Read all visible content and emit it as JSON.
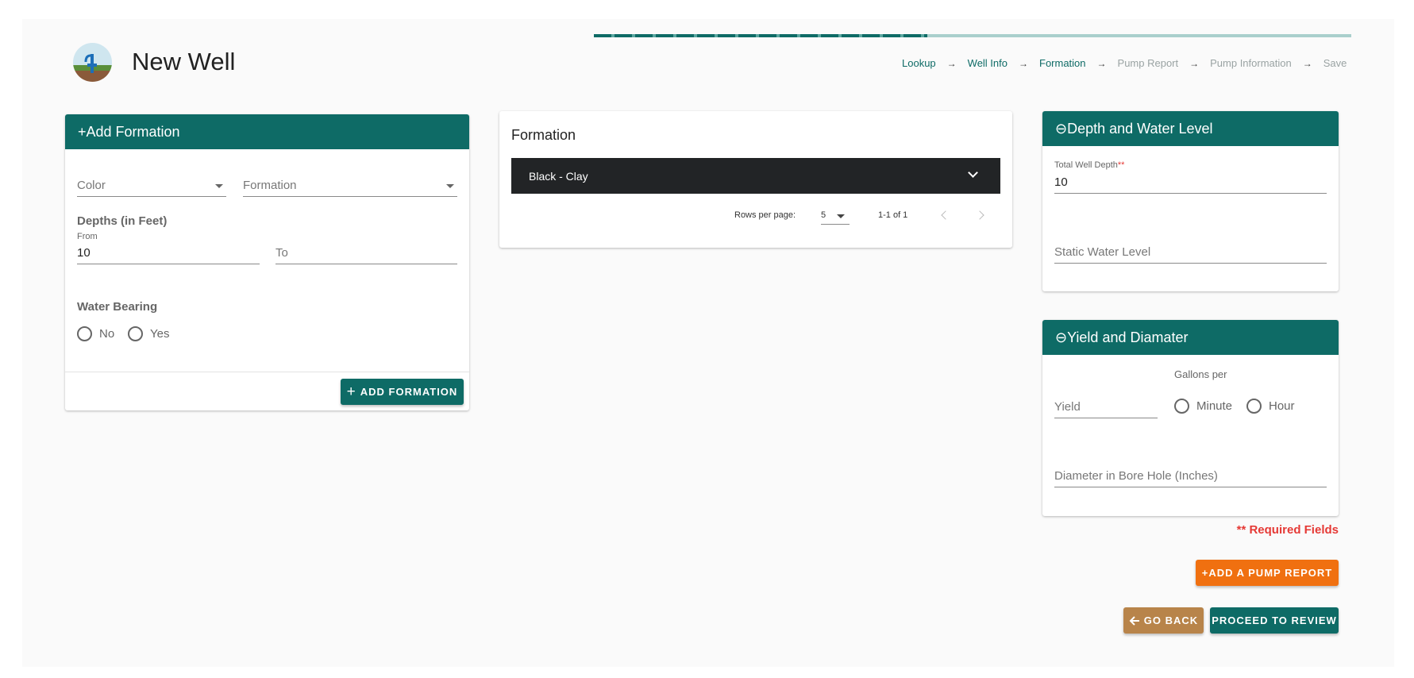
{
  "header": {
    "title": "New Well"
  },
  "progress": {
    "fraction": 0.44
  },
  "steps": [
    {
      "label": "Lookup",
      "state": "done"
    },
    {
      "label": "Well Info",
      "state": "done"
    },
    {
      "label": "Formation",
      "state": "done"
    },
    {
      "label": "Pump Report",
      "state": "todo"
    },
    {
      "label": "Pump Information",
      "state": "todo"
    },
    {
      "label": "Save",
      "state": "todo"
    }
  ],
  "step_arrow": "→",
  "add_formation": {
    "title": "+Add Formation",
    "color_placeholder": "Color",
    "formation_placeholder": "Formation",
    "depths_label": "Depths (in Feet)",
    "from_label": "From",
    "from_value": "10",
    "to_placeholder": "To",
    "water_bearing_label": "Water Bearing",
    "no_label": "No",
    "yes_label": "Yes",
    "button_label": "ADD FORMATION"
  },
  "formation_table": {
    "title": "Formation",
    "rows": [
      "Black - Clay"
    ],
    "rows_per_page_label": "Rows per page:",
    "rows_per_page": "5",
    "range": "1-1 of 1"
  },
  "depth": {
    "title": "⊖Depth and Water Level",
    "total_label": "Total Well Depth",
    "required_mark": "**",
    "total_value": "10",
    "static_placeholder": "Static Water Level"
  },
  "yield": {
    "title": "⊖Yield and Diamater",
    "gallons_label": "Gallons per",
    "yield_placeholder": "Yield",
    "minute_label": "Minute",
    "hour_label": "Hour",
    "diameter_placeholder": "Diameter in Bore Hole (Inches)"
  },
  "required_note": "** Required Fields",
  "actions": {
    "pump_report": "+ADD A PUMP REPORT",
    "go_back": "GO BACK",
    "proceed": "PROCEED TO REVIEW"
  },
  "colors": {
    "primary": "#0e6b66",
    "accent": "#f07010",
    "back": "#b8844a",
    "required": "#e53935"
  }
}
